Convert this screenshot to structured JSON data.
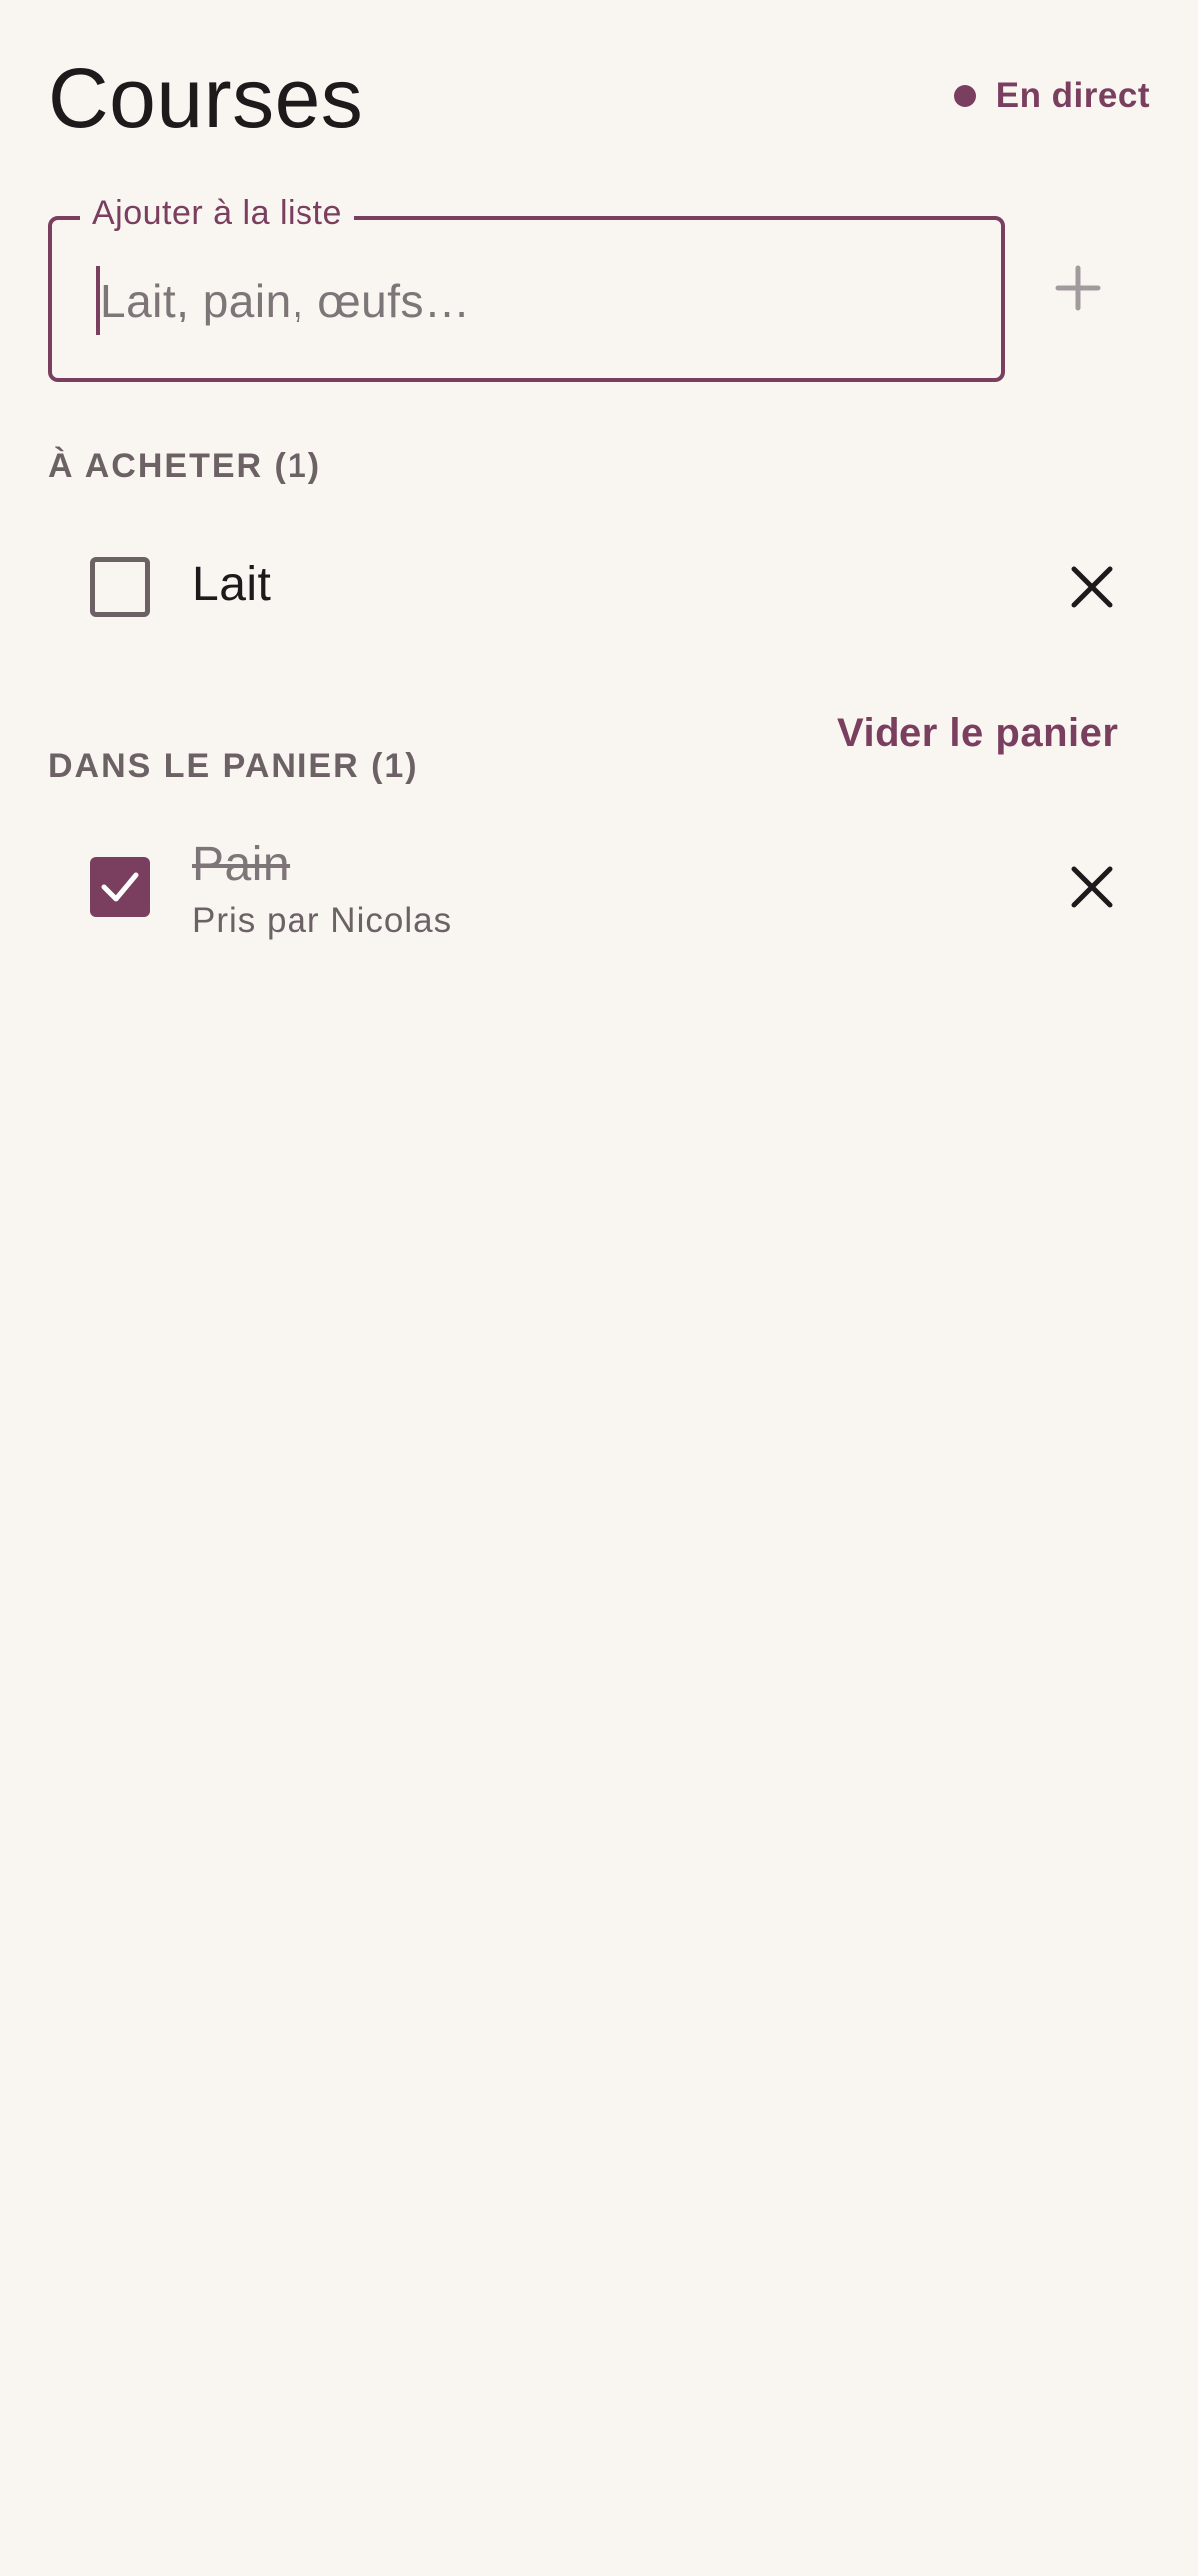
{
  "header": {
    "title": "Courses",
    "live_status": "En direct"
  },
  "add_item": {
    "label": "Ajouter à la liste",
    "placeholder": "Lait, pain, œufs…",
    "value": "",
    "add_icon": "plus-icon"
  },
  "to_buy": {
    "heading": "À ACHETER (1)",
    "items": [
      {
        "name": "Lait",
        "checked": false,
        "delete_icon": "close-icon"
      }
    ]
  },
  "in_cart": {
    "heading": "DANS LE PANIER (1)",
    "clear_label": "Vider le panier",
    "items": [
      {
        "name": "Pain",
        "checked": true,
        "taken_by": "Pris par Nicolas",
        "delete_icon": "close-icon"
      }
    ]
  },
  "colors": {
    "accent": "#7a3f5f",
    "background": "#f9f6f2",
    "text": "#1e1a1c",
    "muted": "#6c6266"
  }
}
